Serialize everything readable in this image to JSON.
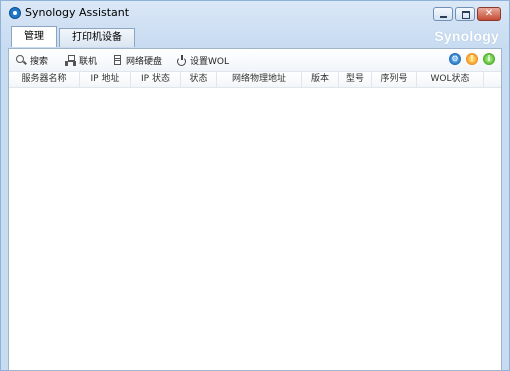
{
  "window": {
    "title": "Synology Assistant"
  },
  "tabs": [
    {
      "label": "管理"
    },
    {
      "label": "打印机设备"
    }
  ],
  "brand": "Synology",
  "toolbar": {
    "search": "搜索",
    "connect": "联机",
    "network_drive": "网络硬盘",
    "wol": "设置WOL"
  },
  "status_icons": [
    "settings-icon",
    "warning-icon",
    "info-icon"
  ],
  "table": {
    "columns": [
      "服务器名称",
      "IP 地址",
      "IP 状态",
      "状态",
      "网络物理地址",
      "版本",
      "型号",
      "序列号",
      "WOL状态"
    ],
    "rows": []
  },
  "colors": {
    "accent": "#1f78c8",
    "warning": "#e57b12",
    "info": "#3a9a1b"
  }
}
